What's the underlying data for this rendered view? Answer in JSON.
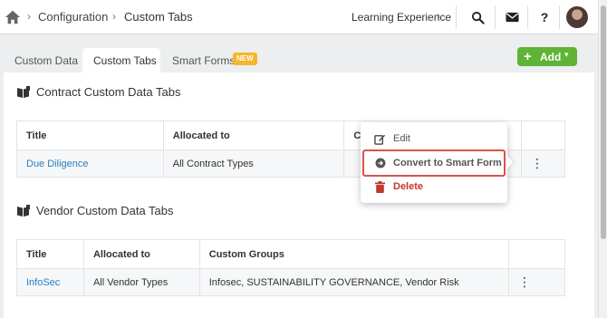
{
  "breadcrumb": {
    "parent": "Configuration",
    "current": "Custom Tabs"
  },
  "header": {
    "learning_experience": "Learning Experience",
    "icons": [
      "search-icon",
      "mail-icon",
      "help-icon",
      "avatar"
    ]
  },
  "tabs": [
    {
      "label": "Custom Data",
      "active": false
    },
    {
      "label": "Custom Tabs",
      "active": true
    },
    {
      "label": "Smart Forms",
      "active": false,
      "badge": "NEW"
    }
  ],
  "add_button": {
    "label": "Add"
  },
  "contract_section": {
    "title": "Contract Custom Data Tabs",
    "columns": [
      "Title",
      "Allocated to",
      "Cu"
    ],
    "rows": [
      {
        "title": "Due Diligence",
        "allocated": "All Contract Types"
      }
    ]
  },
  "context_menu": {
    "items": [
      {
        "label": "Edit",
        "icon": "edit-icon",
        "color": "#555555"
      },
      {
        "label": "Convert to Smart Form",
        "icon": "convert-icon",
        "color": "#555555"
      },
      {
        "label": "Delete",
        "icon": "trash-icon",
        "color": "#c0392b"
      }
    ]
  },
  "vendor_section": {
    "title": "Vendor Custom Data Tabs",
    "columns": [
      "Title",
      "Allocated to",
      "Custom Groups"
    ],
    "rows": [
      {
        "title": "InfoSec",
        "allocated": "All Vendor Types",
        "groups": "Infosec, SUSTAINABILITY GOVERNANCE, Vendor Risk"
      }
    ]
  },
  "colors": {
    "accent_green": "#5fb336",
    "link_blue": "#2a7fc1",
    "badge_orange": "#f5b62b",
    "delete_red": "#c0392b",
    "highlight_red": "#d9534f"
  }
}
